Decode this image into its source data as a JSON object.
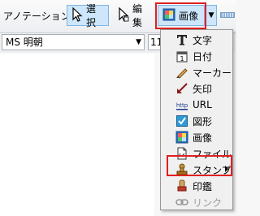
{
  "toolbar": {
    "annotation_label": "アノテーション",
    "select_label": "選択",
    "edit_label": "編集",
    "image_label": "画像",
    "dropdown_arrow": "▼"
  },
  "fontbar": {
    "font_name": "MS 明朝",
    "font_size": "11"
  },
  "menu": {
    "items": [
      {
        "label": "文字",
        "icon": "text-T-icon"
      },
      {
        "label": "日付",
        "icon": "calendar-icon"
      },
      {
        "label": "マーカー",
        "icon": "marker-pen-icon"
      },
      {
        "label": "矢印",
        "icon": "arrow-icon"
      },
      {
        "label": "URL",
        "icon": "url-link-icon"
      },
      {
        "label": "図形",
        "icon": "shape-checkbox-icon"
      },
      {
        "label": "画像",
        "icon": "image-icon"
      },
      {
        "label": "ファイル",
        "icon": "file-icon"
      },
      {
        "label": "スタンプ",
        "icon": "stamp-icon",
        "has_submenu": true
      },
      {
        "label": "印鑑",
        "icon": "seal-icon"
      },
      {
        "label": "リンク",
        "icon": "chain-link-icon",
        "disabled": true
      }
    ]
  },
  "colors": {
    "highlight_red": "#e02020",
    "selected_blue": "#cde6fb"
  }
}
